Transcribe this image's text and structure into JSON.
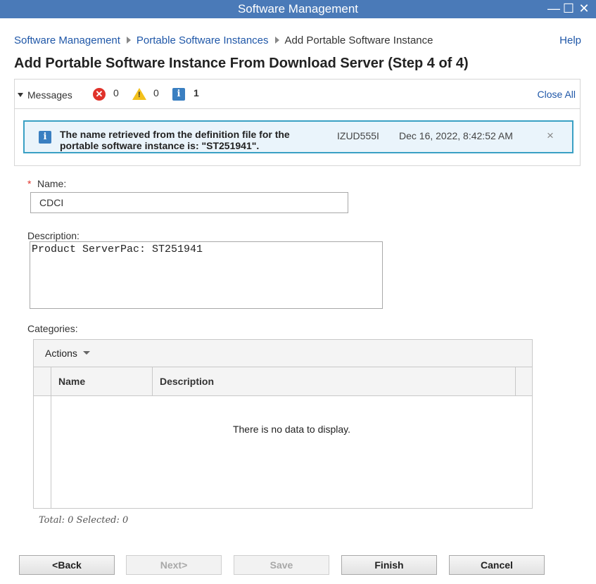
{
  "window": {
    "title": "Software Management",
    "controls": {
      "minimize": "—",
      "maximize": "☐",
      "close": "✕"
    }
  },
  "breadcrumb": {
    "items": [
      "Software Management",
      "Portable Software Instances"
    ],
    "current": "Add Portable Software Instance"
  },
  "help_label": "Help",
  "page_title": "Add Portable Software Instance From Download Server (Step 4 of 4)",
  "messages": {
    "toggle_label": "Messages",
    "error_count": "0",
    "warning_count": "0",
    "info_count": "1",
    "close_all_label": "Close All",
    "items": [
      {
        "text": "The name retrieved from the definition file for the portable software instance is: \"ST251941\".",
        "id": "IZUD555I",
        "timestamp": "Dec 16, 2022, 8:42:52 AM",
        "close_glyph": "×"
      }
    ]
  },
  "form": {
    "required_mark": "*",
    "name_label": "Name:",
    "name_value": "CDCI",
    "description_label": "Description:",
    "description_value": "Product ServerPac: ST251941",
    "categories_label": "Categories:"
  },
  "categories_table": {
    "actions_label": "Actions",
    "columns": [
      "Name",
      "Description"
    ],
    "empty_message": "There is no data to display.",
    "totals": "Total: 0 Selected: 0"
  },
  "buttons": {
    "back": "<Back",
    "next": "Next>",
    "save": "Save",
    "finish": "Finish",
    "cancel": "Cancel"
  },
  "colors": {
    "titlebar": "#4a7ab8",
    "link": "#1f57a8",
    "error": "#e0322a",
    "warning": "#f3c11b",
    "info": "#3a7fc1",
    "message_border": "#3aa0c4"
  }
}
